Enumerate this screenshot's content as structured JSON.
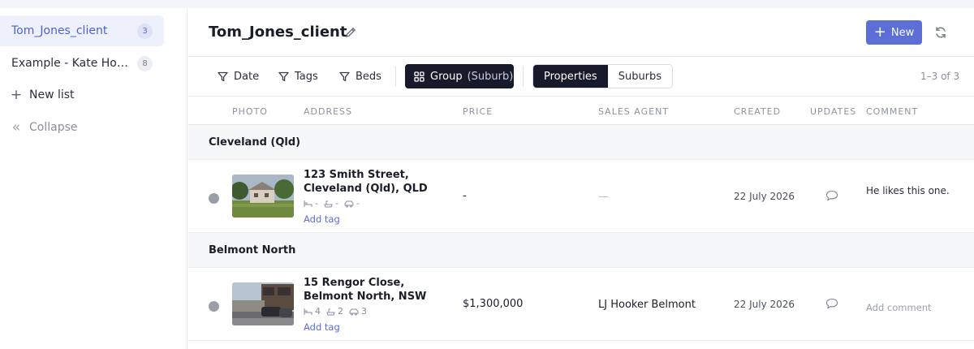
{
  "sidebar": {
    "lists": [
      {
        "label": "Tom_Jones_client",
        "count": "3",
        "active": true
      },
      {
        "label": "Example - Kate Homes",
        "count": "8",
        "active": false
      }
    ],
    "new_list_label": "New list",
    "collapse_label": "Collapse"
  },
  "header": {
    "title": "Tom_Jones_client",
    "new_button_label": "New"
  },
  "toolbar": {
    "filters": [
      "Date",
      "Tags",
      "Beds"
    ],
    "group_label": "Group",
    "group_value": "(Suburb)",
    "view_tabs": [
      {
        "label": "Properties",
        "active": true
      },
      {
        "label": "Suburbs",
        "active": false
      }
    ],
    "pagination": "1–3 of 3"
  },
  "columns": [
    "PHOTO",
    "ADDRESS",
    "PRICE",
    "SALES AGENT",
    "CREATED",
    "UPDATES",
    "COMMENT"
  ],
  "groups": [
    {
      "name": "Cleveland (Qld)",
      "rows": [
        {
          "address": "123 Smith Street, Cleveland (Qld), QLD",
          "beds": "-",
          "baths": "-",
          "cars": "-",
          "add_tag": "Add tag",
          "price": "-",
          "agent": "—",
          "created": "22 July 2026",
          "comment": "He likes this one."
        }
      ]
    },
    {
      "name": "Belmont North",
      "rows": [
        {
          "address": "15 Rengor Close, Belmont North, NSW",
          "beds": "4",
          "baths": "2",
          "cars": "3",
          "add_tag": "Add tag",
          "price": "$1,300,000",
          "agent": "LJ Hooker Belmont",
          "created": "22 July 2026",
          "comment": "Add comment"
        }
      ]
    }
  ],
  "colors": {
    "accent": "#5b6fd6",
    "dark": "#161a2a",
    "active_bg": "#eef1fb",
    "status_dot": "#9a9ea9"
  }
}
